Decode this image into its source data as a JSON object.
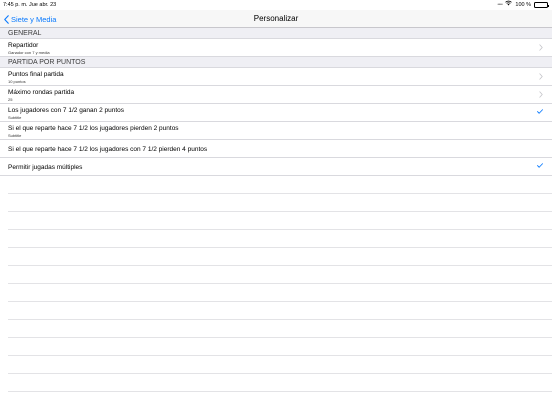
{
  "status_bar": {
    "time_date": "7:45 p. m.   Jue abr. 23",
    "battery_text": "100 %"
  },
  "nav": {
    "back_label": "Siete y Media",
    "title": "Personalizar"
  },
  "sections": {
    "general": {
      "header": "GENERAL",
      "repartidor_title": "Repartidor",
      "repartidor_subtitle": "Ganador con 7 y media"
    },
    "partida": {
      "header": "PARTIDA POR PUNTOS",
      "puntos_title": "Puntos final partida",
      "puntos_subtitle": "10 puntos",
      "rondas_title": "Máximo rondas partida",
      "rondas_subtitle": "25",
      "jugadores_title": "Los jugadores con 7 1/2 ganan 2 puntos",
      "jugadores_subtitle": "Subtitle",
      "reparte2_title": "Si el que reparte hace 7 1/2 los jugadores pierden 2 puntos",
      "reparte2_subtitle": "Subtitle",
      "reparte4_title": "Si el que reparte hace 7 1/2 los jugadores con 7 1/2 pierden 4 puntos",
      "multiples_title": "Permitir jugadas múltiples"
    }
  },
  "accent_color": "#0a7afe",
  "icons": {
    "back": "chevron-left-icon",
    "disclosure": "chevron-right-icon",
    "selected": "checkmark-icon",
    "wifi": "wifi-icon",
    "battery": "battery-icon"
  }
}
